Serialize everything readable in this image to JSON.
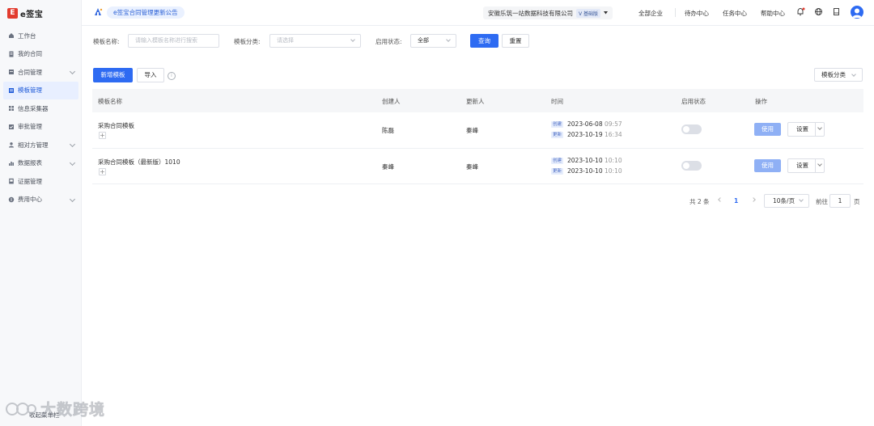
{
  "app": {
    "logo_text": "e签宝",
    "logo_mark": "E"
  },
  "sidebar": {
    "items": [
      {
        "label": "工作台",
        "icon": "home-icon",
        "has_chevron": false
      },
      {
        "label": "我的合同",
        "icon": "document-icon",
        "has_chevron": false
      },
      {
        "label": "合同管理",
        "icon": "folder-icon",
        "has_chevron": true
      },
      {
        "label": "模板管理",
        "icon": "template-icon",
        "has_chevron": false,
        "active": true
      },
      {
        "label": "信息采集器",
        "icon": "grid-icon",
        "has_chevron": false
      },
      {
        "label": "审批管理",
        "icon": "approval-icon",
        "has_chevron": false
      },
      {
        "label": "相对方管理",
        "icon": "contacts-icon",
        "has_chevron": true
      },
      {
        "label": "数据报表",
        "icon": "report-icon",
        "has_chevron": true
      },
      {
        "label": "证据管理",
        "icon": "evidence-icon",
        "has_chevron": false
      },
      {
        "label": "费用中心",
        "icon": "billing-icon",
        "has_chevron": true
      }
    ],
    "collapse_label": "收起菜单栏"
  },
  "header": {
    "notice": "e签宝合同管理更新公告",
    "company": "安徽乐筑一站数据科技有限公司",
    "version_tag": "V 基础版",
    "links": {
      "all_companies": "全部企业",
      "todo": "待办中心",
      "tasks": "任务中心",
      "help": "帮助中心"
    }
  },
  "filters": {
    "name_label": "模板名称:",
    "name_placeholder": "请输入模板名称进行搜索",
    "category_label": "模板分类:",
    "category_placeholder": "请选择",
    "status_label": "启用状态:",
    "status_value": "全部",
    "search_label": "查询",
    "reset_label": "重置"
  },
  "actions": {
    "new_template": "新增模板",
    "import": "导入",
    "category_button": "模板分类"
  },
  "table": {
    "headers": {
      "name": "模板名称",
      "creator": "创建人",
      "updater": "更新人",
      "time": "时间",
      "status": "启用状态",
      "ops": "操作"
    },
    "rows": [
      {
        "name": "采购合同模板",
        "creator": "陈磊",
        "updater": "秦峰",
        "created_tag": "创建",
        "created_date": "2023-06-08",
        "created_time": "09:57",
        "updated_tag": "更新",
        "updated_date": "2023-10-19",
        "updated_time": "16:34",
        "enabled": false,
        "use_label": "使用",
        "settings_label": "设置"
      },
      {
        "name": "采购合同模板（最新版）1010",
        "creator": "秦峰",
        "updater": "秦峰",
        "created_tag": "创建",
        "created_date": "2023-10-10",
        "created_time": "10:10",
        "updated_tag": "更新",
        "updated_date": "2023-10-10",
        "updated_time": "10:10",
        "enabled": false,
        "use_label": "使用",
        "settings_label": "设置"
      }
    ]
  },
  "pagination": {
    "total": "共 2 条",
    "current_page": "1",
    "page_size": "10条/页",
    "goto_label": "前往",
    "goto_value": "1",
    "page_suffix": "页"
  },
  "watermark": {
    "text": "大数跨境"
  },
  "colors": {
    "primary": "#2e6bf2",
    "logo_red": "#e23b2e",
    "disabled_primary": "#8fb0f5"
  }
}
